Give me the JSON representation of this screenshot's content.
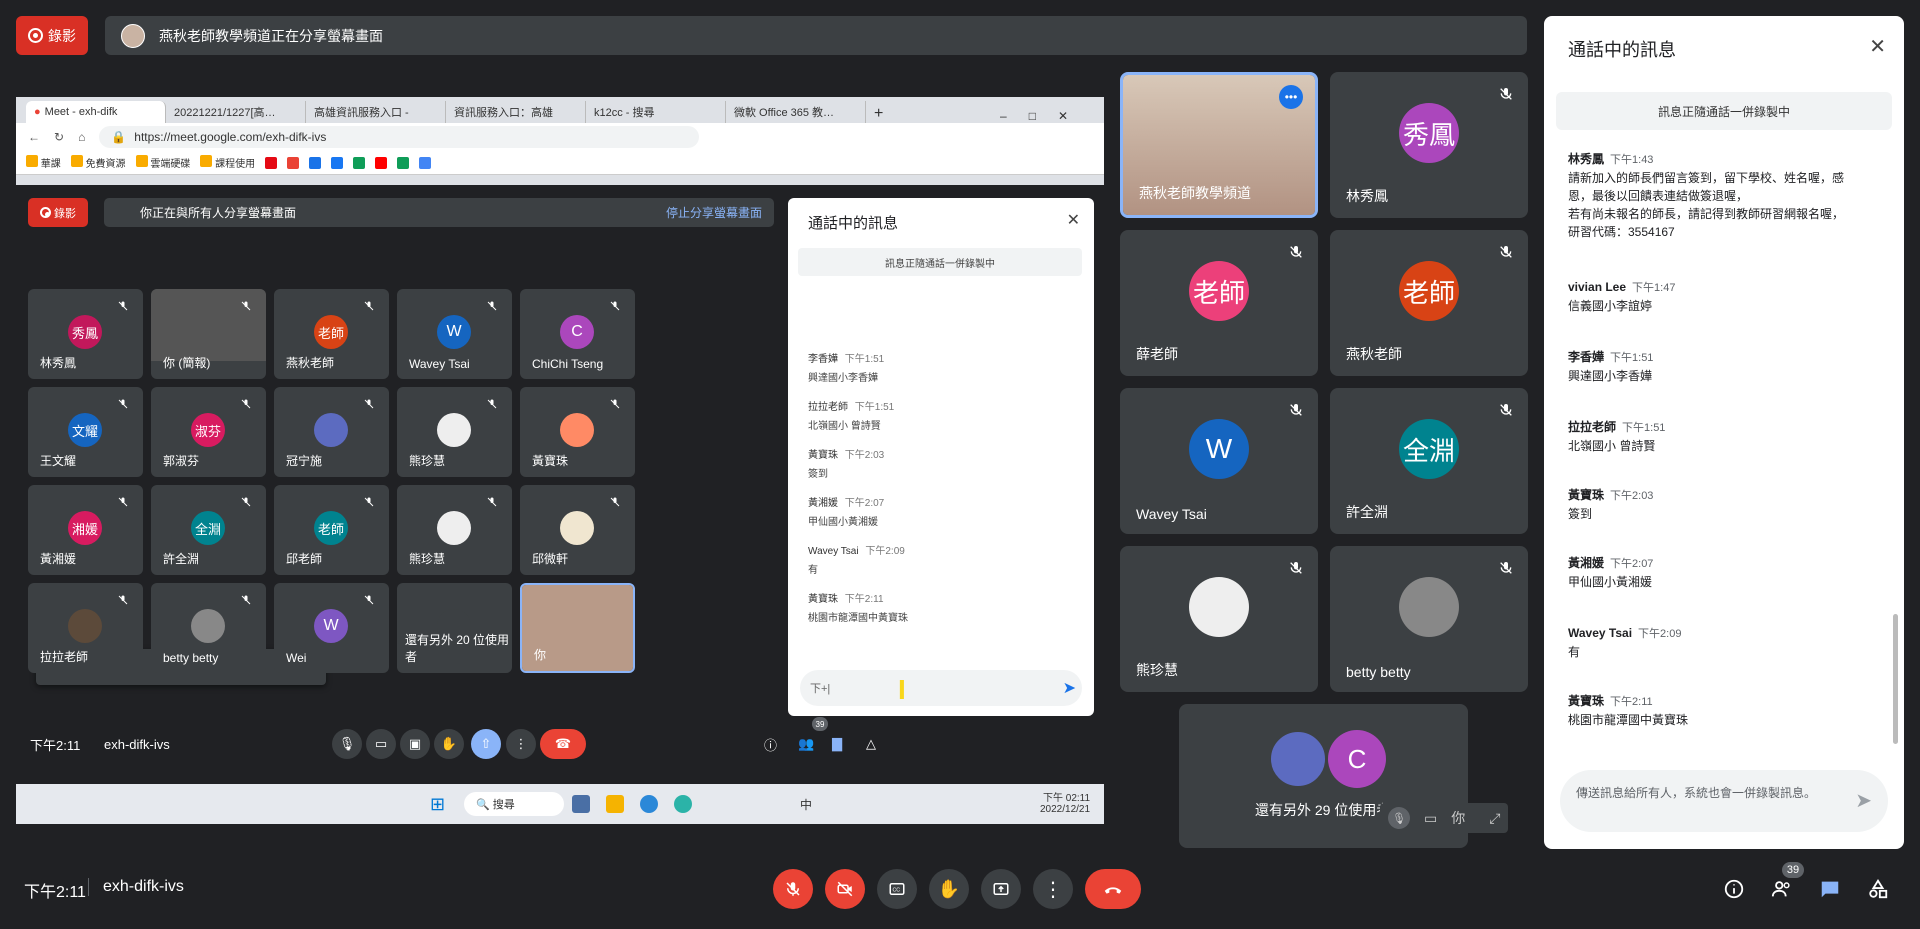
{
  "top": {
    "record_label": "錄影",
    "share_text": "燕秋老師教學頻道正在分享螢幕畫面"
  },
  "browser": {
    "tabs": [
      "Meet - exh-difk",
      "20221221/1227[高…",
      "高雄資訊服務入口 -",
      "資訊服務入口：高雄",
      "k12cc - 搜尋",
      "微軟 Office 365 教…"
    ],
    "url": "https://meet.google.com/exh-difk-ivs",
    "bookmarks": [
      "華課",
      "免費資源",
      "雲端硬碟",
      "課程使用"
    ]
  },
  "inner": {
    "record_label": "錄影",
    "share_text": "你正在與所有人分享螢幕畫面",
    "stop_share": "停止分享螢幕畫面",
    "tiles": [
      {
        "name": "林秀鳳",
        "initials": "秀鳳",
        "color": "#c2185b"
      },
      {
        "name": "你 (簡報)",
        "initials": "",
        "color": "#3c4043"
      },
      {
        "name": "燕秋老師",
        "initials": "老師",
        "color": "#d84315"
      },
      {
        "name": "Wavey Tsai",
        "initials": "W",
        "color": "#1565c0"
      },
      {
        "name": "ChiChi Tseng",
        "initials": "C",
        "color": "#ab47bc"
      },
      {
        "name": "王文耀",
        "initials": "文耀",
        "color": "#1565c0"
      },
      {
        "name": "郭淑芬",
        "initials": "淑芬",
        "color": "#d81b60"
      },
      {
        "name": "冠宁施",
        "initials": "",
        "color": "#5c6bc0"
      },
      {
        "name": "熊珍慧",
        "initials": "",
        "color": "#eee"
      },
      {
        "name": "黃寶珠",
        "initials": "",
        "color": "#ff8a65"
      },
      {
        "name": "黃湘媛",
        "initials": "湘媛",
        "color": "#d81b60"
      },
      {
        "name": "許全淵",
        "initials": "全淵",
        "color": "#00838f"
      },
      {
        "name": "邱老師",
        "initials": "老師",
        "color": "#00838f"
      },
      {
        "name": "熊珍慧",
        "initials": "",
        "color": "#eee"
      },
      {
        "name": "邱微軒",
        "initials": "",
        "color": "#f0e6d0"
      },
      {
        "name": "拉拉老師",
        "initials": "",
        "color": "#5c4a3a"
      },
      {
        "name": "betty betty",
        "initials": "",
        "color": "#888"
      },
      {
        "name": "Wei",
        "initials": "W",
        "color": "#7e57c2"
      },
      {
        "name": "還有另外 20 位使用者",
        "initials": "",
        "color": "#3c4043"
      },
      {
        "name": "你",
        "initials": "",
        "color": "#b89a88"
      }
    ],
    "toast": "熊珍慧已離開會議",
    "time": "下午2:11",
    "code": "exh-difk-ivs",
    "people_count": "39",
    "chat_title": "通話中的訊息",
    "chat_banner": "訊息正隨通話一併錄製中",
    "chat_msgs": [
      {
        "who": "李香嬅",
        "time": "下午1:51",
        "text": "興達國小李香嬅"
      },
      {
        "who": "拉拉老師",
        "time": "下午1:51",
        "text": "北嶺國小 曾詩賢"
      },
      {
        "who": "黃寶珠",
        "time": "下午2:03",
        "text": "簽到"
      },
      {
        "who": "黃湘媛",
        "time": "下午2:07",
        "text": "甲仙國小黃湘媛"
      },
      {
        "who": "Wavey Tsai",
        "time": "下午2:09",
        "text": "有"
      },
      {
        "who": "黃寶珠",
        "time": "下午2:11",
        "text": "桃園市龍潭國中黃寶珠"
      }
    ],
    "input_text": "下+|",
    "taskbar_search": "搜尋",
    "taskbar_time": "下午 02:11",
    "taskbar_date": "2022/12/21",
    "taskbar_lang": "中"
  },
  "right_tiles": [
    {
      "name": "燕秋老師教學頻道",
      "initials": "",
      "color": "#caa999"
    },
    {
      "name": "林秀鳳",
      "initials": "秀鳳",
      "color": "#ab47bc"
    },
    {
      "name": "薛老師",
      "initials": "老師",
      "color": "#ec407a"
    },
    {
      "name": "燕秋老師",
      "initials": "老師",
      "color": "#d84315"
    },
    {
      "name": "Wavey Tsai",
      "initials": "W",
      "color": "#1565c0"
    },
    {
      "name": "許全淵",
      "initials": "全淵",
      "color": "#00838f"
    },
    {
      "name": "熊珍慧",
      "initials": "",
      "color": "#eee"
    },
    {
      "name": "betty betty",
      "initials": "",
      "color": "#888"
    },
    {
      "name": "還有另外 29 位使用者",
      "initials": "C",
      "color": "#ab47bc"
    }
  ],
  "self_label": "你",
  "chat": {
    "title": "通話中的訊息",
    "banner": "訊息正隨通話一併錄製中",
    "messages": [
      {
        "who": "林秀鳳",
        "time": "下午1:43",
        "lines": [
          "請新加入的師長們留言簽到，留下學校、姓名喔，感",
          "恩，最後以回饋表連結做簽退喔，",
          "若有尚未報名的師長，請記得到教師研習網報名喔，",
          "研習代碼：3554167"
        ]
      },
      {
        "who": "vivian Lee",
        "time": "下午1:47",
        "lines": [
          "信義國小李誼婷"
        ]
      },
      {
        "who": "李香嬅",
        "time": "下午1:51",
        "lines": [
          "興達國小李香嬅"
        ]
      },
      {
        "who": "拉拉老師",
        "time": "下午1:51",
        "lines": [
          "北嶺國小 曾詩賢"
        ]
      },
      {
        "who": "黃寶珠",
        "time": "下午2:03",
        "lines": [
          "簽到"
        ]
      },
      {
        "who": "黃湘媛",
        "time": "下午2:07",
        "lines": [
          "甲仙國小黃湘媛"
        ]
      },
      {
        "who": "Wavey Tsai",
        "time": "下午2:09",
        "lines": [
          "有"
        ]
      },
      {
        "who": "黃寶珠",
        "time": "下午2:11",
        "lines": [
          "桃園市龍潭國中黃寶珠"
        ]
      }
    ],
    "placeholder": "傳送訊息給所有人，系統也會一併錄製訊息。"
  },
  "bottom": {
    "time": "下午2:11",
    "code": "exh-difk-ivs",
    "people_count": "39"
  }
}
